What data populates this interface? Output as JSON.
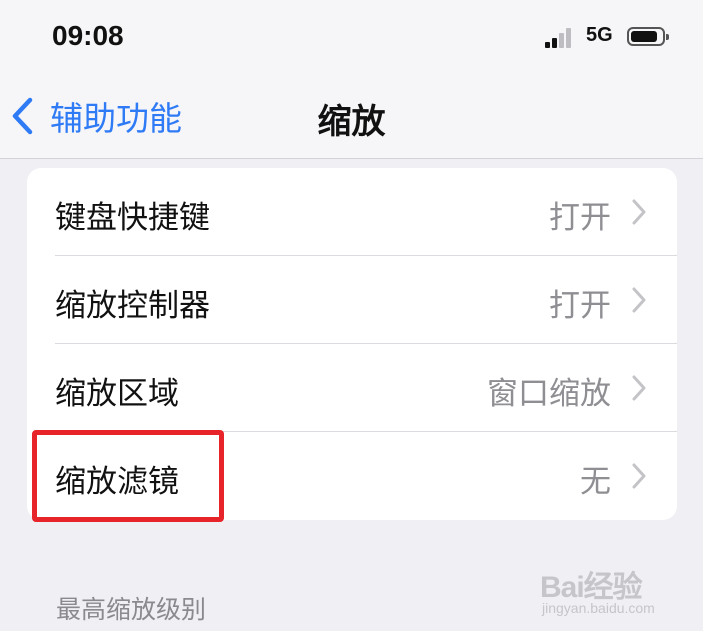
{
  "status_bar": {
    "time": "09:08",
    "network": "5G"
  },
  "nav": {
    "back_label": "辅助功能",
    "title": "缩放"
  },
  "rows": [
    {
      "label": "键盘快捷键",
      "value": "打开"
    },
    {
      "label": "缩放控制器",
      "value": "打开"
    },
    {
      "label": "缩放区域",
      "value": "窗口缩放"
    },
    {
      "label": "缩放滤镜",
      "value": "无"
    }
  ],
  "section_header": "最高缩放级别",
  "watermark": {
    "logo": "Bai经验",
    "url": "jingyan.baidu.com"
  },
  "colors": {
    "accent": "#2f7bf6",
    "highlight": "#e8242b",
    "secondary_text": "#8e8e93",
    "background": "#efeff4"
  },
  "icons": {
    "back": "chevron-left-icon",
    "row_disclosure": "chevron-right-icon",
    "signal": "cellular-signal-icon",
    "battery": "battery-icon"
  }
}
